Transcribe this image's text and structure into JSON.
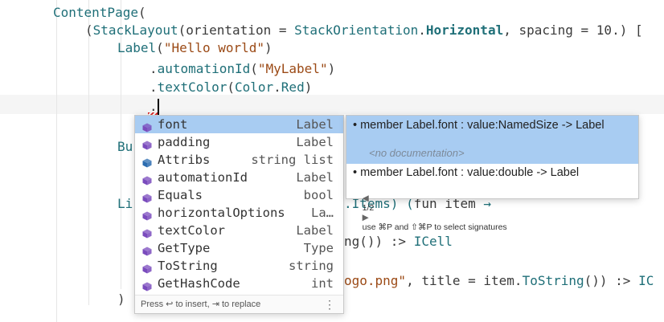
{
  "code_lines": [
    {
      "id": "l1",
      "parts": [
        {
          "t": "ContentPage",
          "c": "fn"
        },
        {
          "t": "(",
          "c": ""
        }
      ]
    },
    {
      "id": "l2",
      "parts": [
        {
          "t": "(",
          "c": ""
        },
        {
          "t": "StackLayout",
          "c": "fn"
        },
        {
          "t": "(orientation = ",
          "c": ""
        },
        {
          "t": "StackOrientation",
          "c": "type"
        },
        {
          "t": ".",
          "c": ""
        },
        {
          "t": "Horizontal",
          "c": "enum"
        },
        {
          "t": ", spacing = 10.) [",
          "c": ""
        }
      ]
    },
    {
      "id": "l3",
      "parts": [
        {
          "t": "Label",
          "c": "fn"
        },
        {
          "t": "(",
          "c": ""
        },
        {
          "t": "\"Hello world\"",
          "c": "str"
        },
        {
          "t": ")",
          "c": ""
        }
      ]
    },
    {
      "id": "l4",
      "parts": [
        {
          "t": ".",
          "c": ""
        },
        {
          "t": "automationId",
          "c": "fn"
        },
        {
          "t": "(",
          "c": ""
        },
        {
          "t": "\"MyLabel\"",
          "c": "str"
        },
        {
          "t": ")",
          "c": ""
        }
      ]
    },
    {
      "id": "l5",
      "parts": [
        {
          "t": ".",
          "c": ""
        },
        {
          "t": "textColor",
          "c": "fn"
        },
        {
          "t": "(",
          "c": ""
        },
        {
          "t": "Color",
          "c": "type"
        },
        {
          "t": ".",
          "c": ""
        },
        {
          "t": "Red",
          "c": "type"
        },
        {
          "t": ")",
          "c": ""
        }
      ]
    },
    {
      "id": "l6",
      "parts": [
        {
          "t": ".",
          "c": ""
        }
      ]
    },
    {
      "id": "l7",
      "parts": [
        {
          "t": "Bu",
          "c": "fn"
        }
      ]
    },
    {
      "id": "l8",
      "parts": [
        {
          "t": "Li",
          "c": "fn"
        }
      ]
    },
    {
      "id": "l8b",
      "parts": [
        {
          "t": ".Items) (",
          "c": "fn"
        },
        {
          "t": "fun",
          "c": "kw"
        },
        {
          "t": " item ",
          "c": ""
        },
        {
          "t": "→",
          "c": "fn"
        }
      ]
    },
    {
      "id": "l9",
      "parts": [
        {
          "t": "ng()) :> ",
          "c": ""
        },
        {
          "t": "ICell",
          "c": "type"
        }
      ]
    },
    {
      "id": "l10",
      "parts": [
        {
          "t": "ogo.png\"",
          "c": "str"
        },
        {
          "t": ", title = item.",
          "c": ""
        },
        {
          "t": "ToString",
          "c": "fn"
        },
        {
          "t": "()) :> ",
          "c": ""
        },
        {
          "t": "IC",
          "c": "type"
        }
      ]
    },
    {
      "id": "l11",
      "parts": [
        {
          "t": ")",
          "c": ""
        }
      ]
    }
  ],
  "completion": {
    "items": [
      {
        "label": "font",
        "type": "Label",
        "kind": "method",
        "selected": true
      },
      {
        "label": "padding",
        "type": "Label",
        "kind": "method",
        "selected": false
      },
      {
        "label": "Attribs",
        "type": "string list",
        "kind": "field",
        "selected": false
      },
      {
        "label": "automationId",
        "type": "Label",
        "kind": "method",
        "selected": false
      },
      {
        "label": "Equals",
        "type": "bool",
        "kind": "method",
        "selected": false
      },
      {
        "label": "horizontalOptions",
        "type": "La…",
        "kind": "method",
        "selected": false
      },
      {
        "label": "textColor",
        "type": "Label",
        "kind": "method",
        "selected": false
      },
      {
        "label": "GetType",
        "type": "Type",
        "kind": "method",
        "selected": false
      },
      {
        "label": "ToString",
        "type": "string",
        "kind": "method",
        "selected": false
      },
      {
        "label": "GetHashCode",
        "type": "int",
        "kind": "method",
        "selected": false
      }
    ],
    "footer_hint": "Press ↩ to insert, ⇥ to replace",
    "more_glyph": "⋮"
  },
  "doc": {
    "signature_1": "• member Label.font : value:NamedSize -> Label",
    "no_doc": "<no documentation>",
    "signature_2": "• member Label.font : value:double -> Label",
    "nav_left": "◀",
    "nav_count": "1/2",
    "nav_right": "▶",
    "nav_hint": "use ⌘P and ⇧⌘P to select signatures"
  },
  "colors": {
    "selection": "#a8ccf2",
    "method_icon": "#7a4bbd",
    "field_icon": "#2b6cb0",
    "function": "#1f6f78",
    "string": "#9b4a16"
  },
  "icons": {
    "method": "cube-icon",
    "field": "field-cube-icon"
  }
}
